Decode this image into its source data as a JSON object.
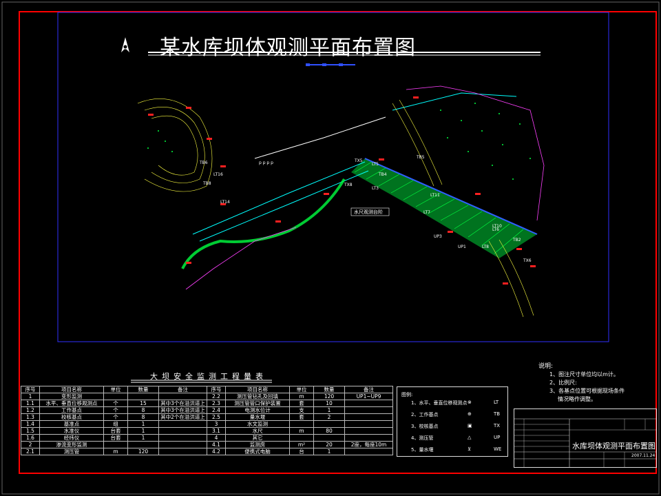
{
  "title": "某水库坝体观测平面布置图",
  "map": {
    "station_label": "水尺观测台阶",
    "point_labels": [
      "TB6",
      "LT16",
      "TB8",
      "LT14",
      "TX5",
      "LT5",
      "TB4",
      "TX8",
      "LT3",
      "TB5",
      "LT11",
      "LT7",
      "LT6",
      "LT8",
      "TB2",
      "UP1",
      "UP3",
      "LT10",
      "TX6"
    ],
    "river_text": "p p p p"
  },
  "quantity_table": {
    "title": "大坝安全监测工程量表",
    "headers": [
      "序号",
      "项目名称",
      "单位",
      "数量",
      "备注"
    ],
    "left_rows": [
      [
        "1",
        "变形监测",
        "",
        "",
        ""
      ],
      [
        "1.1",
        "水平、垂直位移观测点",
        "个",
        "15",
        "其中3个在溢洪道上"
      ],
      [
        "1.2",
        "工作基点",
        "个",
        "8",
        "其中3个在溢洪道上"
      ],
      [
        "1.3",
        "校核基点",
        "个",
        "8",
        "其中2个在溢洪道上"
      ],
      [
        "1.4",
        "基准点",
        "组",
        "1",
        ""
      ],
      [
        "1.5",
        "水准仪",
        "台套",
        "1",
        ""
      ],
      [
        "1.6",
        "经纬仪",
        "台套",
        "1",
        ""
      ],
      [
        "2",
        "渗流变形监测",
        "",
        "",
        ""
      ],
      [
        "2.1",
        "测压管",
        "m",
        "120",
        ""
      ]
    ],
    "right_rows": [
      [
        "2.2",
        "测压管钻孔及回填",
        "m",
        "120",
        "UP1~UP9"
      ],
      [
        "2.3",
        "测压管管口保护装置",
        "套",
        "10",
        ""
      ],
      [
        "2.4",
        "电测水位计",
        "支",
        "1",
        ""
      ],
      [
        "2.5",
        "量水堰",
        "套",
        "2",
        ""
      ],
      [
        "3",
        "水文监测",
        "",
        "",
        ""
      ],
      [
        "3.1",
        "水尺",
        "m",
        "80",
        ""
      ],
      [
        "4",
        "其它",
        "",
        "",
        ""
      ],
      [
        "4.1",
        "监测房",
        "m²",
        "20",
        "2座，每座10m"
      ],
      [
        "4.2",
        "便携式电脑",
        "台",
        "1",
        ""
      ]
    ]
  },
  "legend": {
    "header": "图例:",
    "items": [
      {
        "label": "1、水平、垂直位移观测点",
        "symbol": "⊗",
        "code": "LT"
      },
      {
        "label": "2、工作基点",
        "symbol": "⊕",
        "code": "TB"
      },
      {
        "label": "3、校核基点",
        "symbol": "▣",
        "code": "TX"
      },
      {
        "label": "4、测压管",
        "symbol": "△",
        "code": "UP"
      },
      {
        "label": "5、量水堰",
        "symbol": "⊻",
        "code": "WE"
      }
    ]
  },
  "notes": {
    "header": "说明:",
    "lines": [
      "1、图注尺寸单位均以m计。",
      "2、比例尺:",
      "3、各基点位置可根据现场条件",
      "情况略作调整。"
    ]
  },
  "title_block": {
    "drawing_name": "水库坝体观测平面布置图",
    "date": "2007.11.24"
  },
  "colors": {
    "frame": "#ff0000",
    "inner": "#3030ff",
    "dam": "#00ff40",
    "contour": "#ffff40",
    "marker": "#ff2020",
    "road": "#00ffff",
    "boundary": "#ff40ff"
  }
}
